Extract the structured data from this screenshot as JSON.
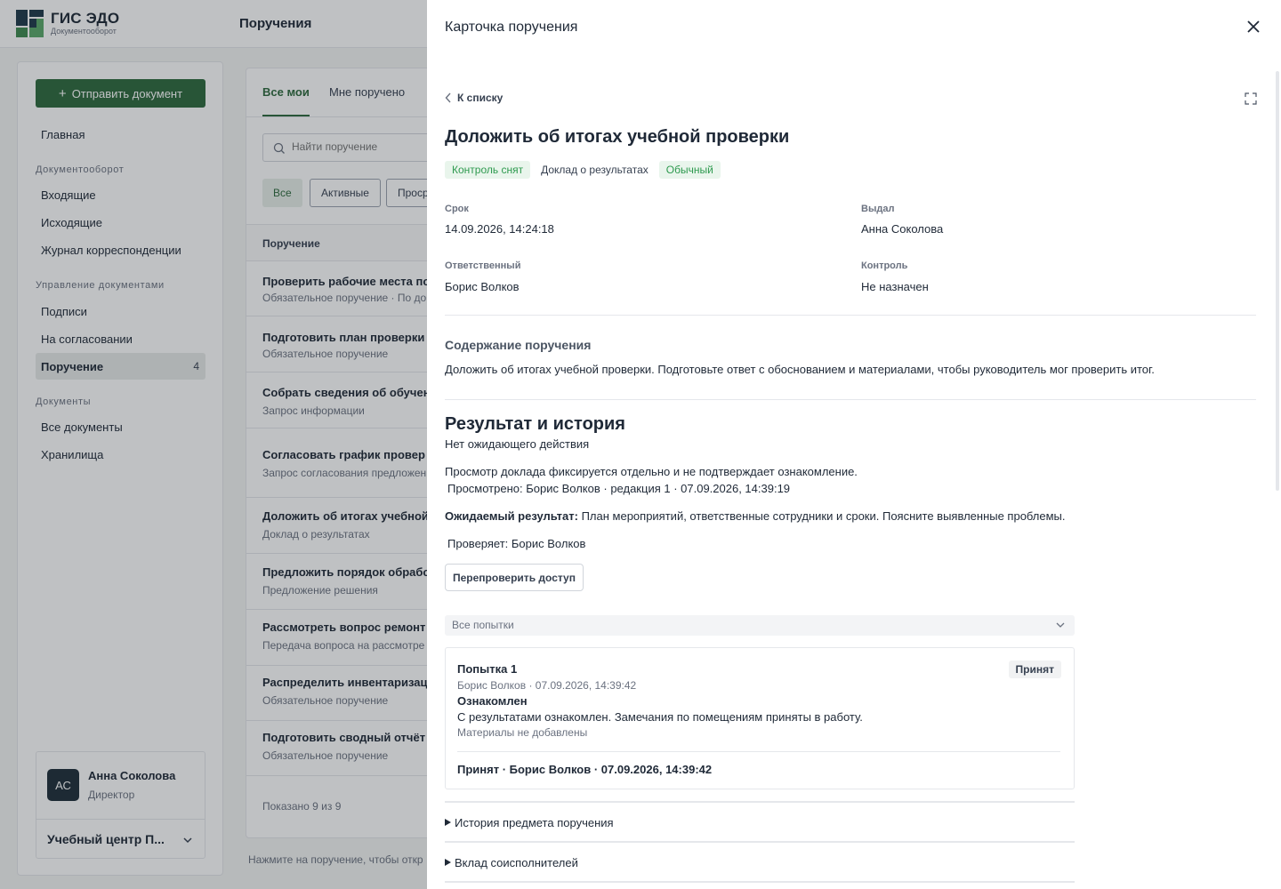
{
  "brand": {
    "title": "ГИС ЭДО",
    "subtitle": "Документооборот"
  },
  "header": {
    "page_title": "Поручения"
  },
  "colors": {
    "accent": "#2f6a3e",
    "status_green": "#2e9a4f",
    "badge_green_bg": "#e9f5ec"
  },
  "sidebar": {
    "send_button": "Отправить документ",
    "items": {
      "home": "Главная",
      "group_docflow": "Документооборот",
      "incoming": "Входящие",
      "outgoing": "Исходящие",
      "journal": "Журнал корреспонденции",
      "group_manage": "Управление документами",
      "signatures": "Подписи",
      "approval": "На согласовании",
      "assignments": "Поручение",
      "assignments_count": "4",
      "group_docs": "Документы",
      "all_docs": "Все документы",
      "storage": "Хранилища"
    },
    "user": {
      "initials": "АС",
      "name": "Анна Соколова",
      "role": "Директор",
      "org": "Учебный центр П..."
    }
  },
  "list": {
    "tabs": [
      "Все мои",
      "Мне поручено"
    ],
    "search_placeholder": "Найти поручение",
    "filters": [
      "Все",
      "Активные",
      "Проср"
    ],
    "column_header": "Поручение",
    "rows": [
      {
        "title": "Проверить рабочие места по",
        "sub": "Обязательное поручение · По до"
      },
      {
        "title": "Подготовить план проверки",
        "sub": "Обязательное поручение"
      },
      {
        "title": "Собрать сведения об обучен",
        "sub": "Запрос информации"
      },
      {
        "title": "Согласовать график провер",
        "sub": "Запрос согласования предложен"
      },
      {
        "title": "Доложить об итогах учебной",
        "sub": "Доклад о результатах"
      },
      {
        "title": "Предложить порядок обрабо",
        "sub": "Предложение решения"
      },
      {
        "title": "Рассмотреть вопрос ремонт",
        "sub": "Передача вопроса на рассмотре"
      },
      {
        "title": "Распределить инвентаризац",
        "sub": "Обязательное поручение"
      },
      {
        "title": "Подготовить сводный отчёт",
        "sub": "Обязательное поручение"
      }
    ],
    "footer": "Показано 9 из 9",
    "hint": "Нажмите на поручение, чтобы откр"
  },
  "drawer": {
    "title": "Карточка поручения",
    "back_label": "К списку",
    "card_title": "Доложить об итогах учебной проверки",
    "badges": {
      "control": "Контроль снят",
      "type": "Доклад о результатах",
      "priority": "Обычный"
    },
    "fields": {
      "deadline_label": "Срок",
      "deadline_value": "14.09.2026, 14:24:18",
      "issuer_label": "Выдал",
      "issuer_value": "Анна Соколова",
      "responsible_label": "Ответственный",
      "responsible_value": "Борис Волков",
      "control_label": "Контроль",
      "control_value": "Не назначен"
    },
    "content_heading": "Содержание поручения",
    "content_text": "Доложить об итогах учебной проверки. Подготовьте ответ с обоснованием и материалами, чтобы руководитель мог проверить итог.",
    "result_heading": "Результат и история",
    "no_pending": "Нет ожидающего действия",
    "view_note": "Просмотр доклада фиксируется отдельно и не подтверждает ознакомление.",
    "viewed": "Просмотрено: Борис Волков · редакция 1 · 07.09.2026, 14:39:19",
    "expected_label": "Ожидаемый результат:",
    "expected_text": "План мероприятий, ответственные сотрудники и сроки. Поясните выявленные проблемы.",
    "checker": "Проверяет: Борис Волков",
    "recheck_button": "Перепроверить доступ",
    "attempts_select": "Все попытки",
    "attempt": {
      "title": "Попытка 1",
      "badge": "Принят",
      "meta": "Борис Волков · 07.09.2026, 14:39:42",
      "status": "Ознакомлен",
      "comment": "С результатами ознакомлен. Замечания по помещениям приняты в работу.",
      "materials": "Материалы не добавлены",
      "accepted": "Принят · Борис Волков · 07.09.2026, 14:39:42"
    },
    "sections": [
      "История предмета поручения",
      "Вклад соисполнителей"
    ]
  }
}
